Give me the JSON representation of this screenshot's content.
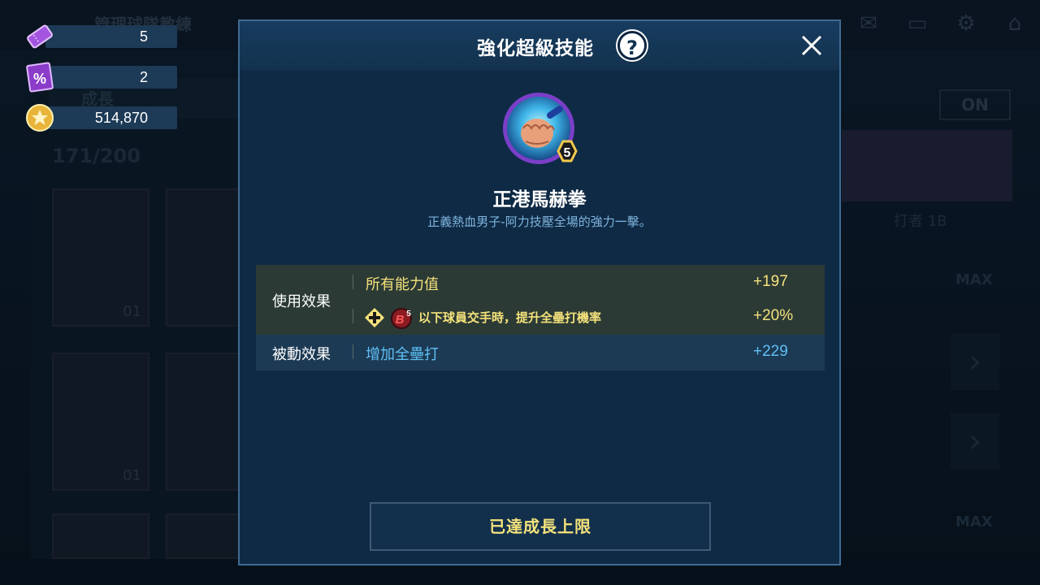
{
  "hud": {
    "tickets": "5",
    "coupons": "2",
    "coins": "514,870"
  },
  "background": {
    "title": "管理球隊教練",
    "growth_tab": "成長",
    "roster_count": "171/200",
    "on_toggle": "ON",
    "batter_label": "打者 1B",
    "max_label": "MAX",
    "card_number": "01"
  },
  "modal": {
    "title": "強化超級技能",
    "help_symbol": "?",
    "skill": {
      "name": "正港馬赫拳",
      "level": "5",
      "description": "正義熱血男子-阿力技壓全場的強力一擊。"
    },
    "active_effect": {
      "label": "使用效果",
      "stat_name": "所有能力值",
      "stat_value": "+197",
      "condition_text": "以下球員交手時，提升全壘打機率",
      "condition_value": "+20%",
      "badge": "B5"
    },
    "passive_effect": {
      "label": "被動效果",
      "stat_name": "增加全壘打",
      "stat_value": "+229"
    },
    "button_label": "已達成長上限"
  },
  "colors": {
    "accent_yellow": "#f5e27b",
    "passive_blue": "#5fc0f5",
    "modal_bg": "#0f2a45",
    "modal_border": "#3f6b93"
  }
}
